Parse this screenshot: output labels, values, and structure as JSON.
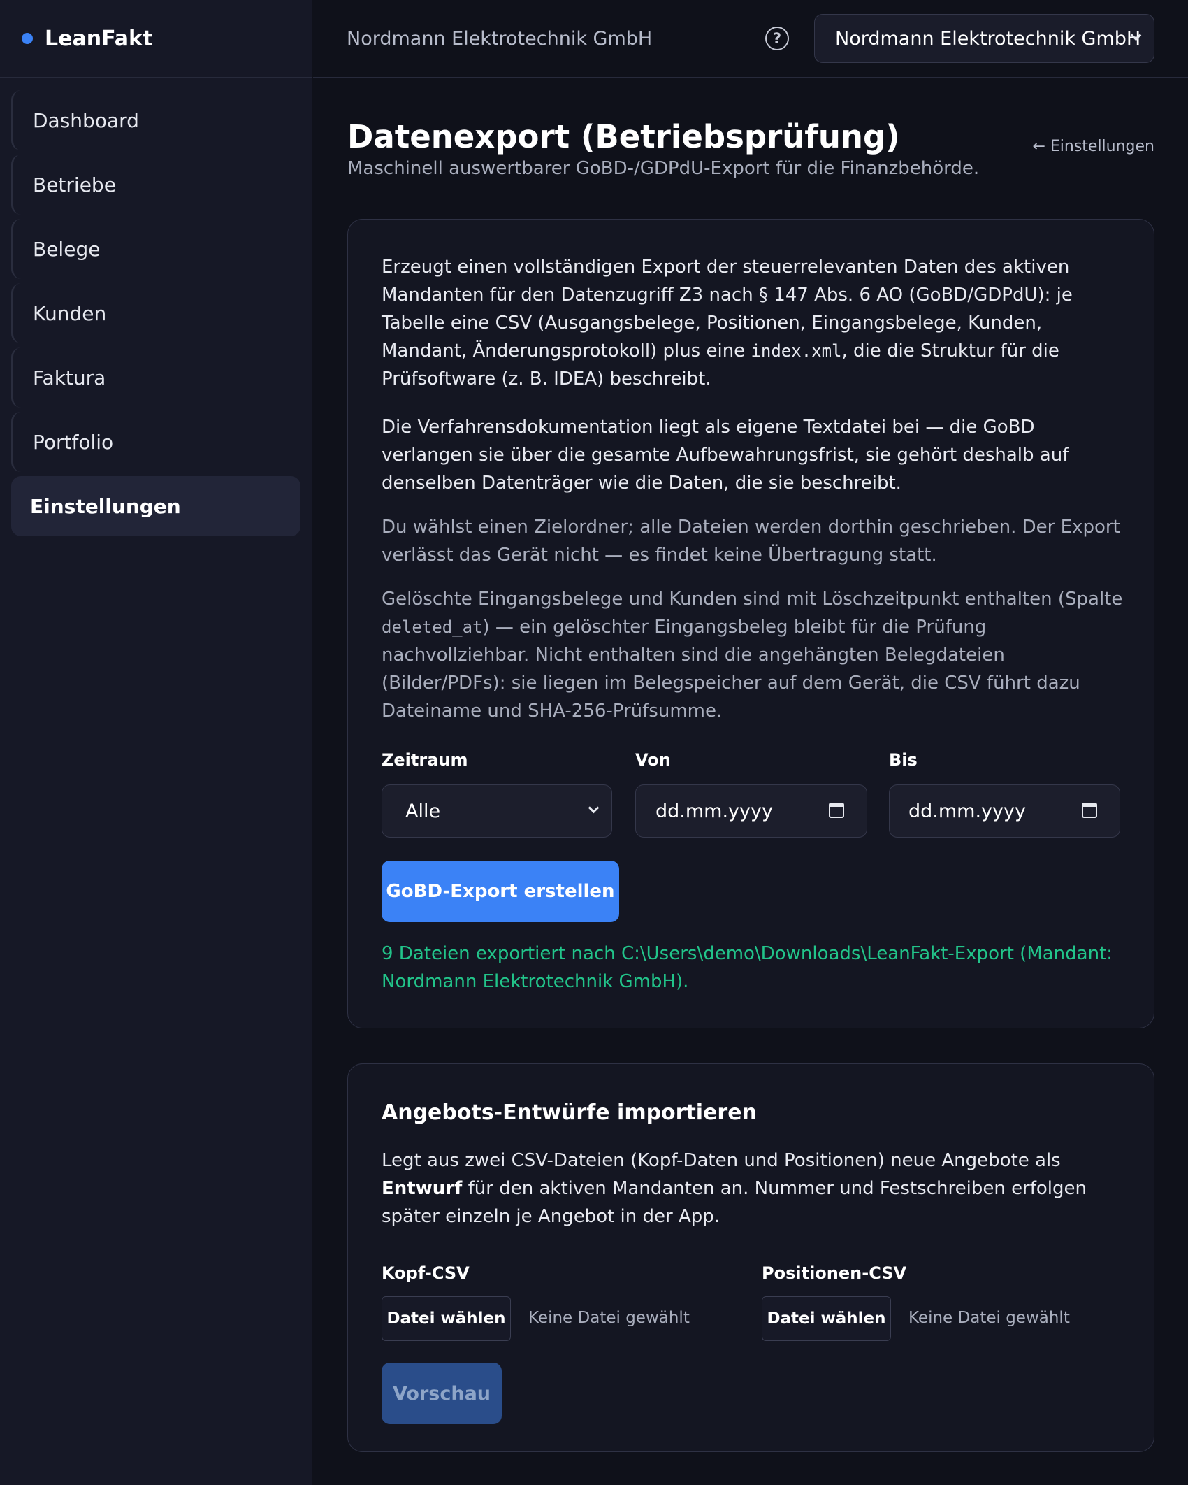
{
  "app": {
    "name": "LeanFakt"
  },
  "sidebar": {
    "items": [
      {
        "label": "Dashboard"
      },
      {
        "label": "Betriebe"
      },
      {
        "label": "Belege"
      },
      {
        "label": "Kunden"
      },
      {
        "label": "Faktura"
      },
      {
        "label": "Portfolio"
      },
      {
        "label": "Einstellungen",
        "active": true
      }
    ]
  },
  "topbar": {
    "company": "Nordmann Elektrotechnik GmbH",
    "help_icon": "question-circle-icon",
    "help_glyph": "?",
    "tenant_selected": "Nordmann Elektrotechnik GmbH"
  },
  "page": {
    "title": "Datenexport (Betriebsprüfung)",
    "subtitle": "Maschinell auswertbarer GoBD-/GDPdU-Export für die Finanzbehörde.",
    "back_link": "← Einstellungen"
  },
  "export": {
    "p1_a": "Erzeugt einen vollständigen Export der steuerrelevanten Daten des aktiven Mandanten für den Datenzugriff Z3 nach § 147 Abs. 6 AO (GoBD/GDPdU): je Tabelle eine CSV (Ausgangsbelege, Positionen, Eingangsbelege, Kunden, Mandant, Änderungsprotokoll) plus eine ",
    "p1_code": "index.xml",
    "p1_b": ", die die Struktur für die Prüfsoftware (z. B. IDEA) beschreibt.",
    "p2": "Die Verfahrensdokumentation liegt als eigene Textdatei bei — die GoBD verlangen sie über die gesamte Aufbewahrungsfrist, sie gehört deshalb auf denselben Datenträger wie die Daten, die sie beschreibt.",
    "p3": "Du wählst einen Zielordner; alle Dateien werden dorthin geschrieben. Der Export verlässt das Gerät nicht — es findet keine Übertragung statt.",
    "p4_a": "Gelöschte Eingangsbelege und Kunden sind mit Löschzeitpunkt enthalten (Spalte ",
    "p4_code": "deleted_at",
    "p4_b": ") — ein gelöschter Eingangsbeleg bleibt für die Prüfung nachvollziehbar. Nicht enthalten sind die angehängten Belegdateien (Bilder/PDFs): sie liegen im Belegspeicher auf dem Gerät, die CSV führt dazu Dateiname und SHA-256-Prüfsumme.",
    "zeitraum_label": "Zeitraum",
    "zeitraum_value": "Alle",
    "von_label": "Von",
    "von_placeholder": "dd.mm.yyyy",
    "bis_label": "Bis",
    "bis_placeholder": "dd.mm.yyyy",
    "button": "GoBD-Export erstellen",
    "result": "9 Dateien exportiert nach C:\\Users\\demo\\Downloads\\LeanFakt-Export (Mandant: Nordmann Elektrotechnik GmbH)."
  },
  "import": {
    "title": "Angebots-Entwürfe importieren",
    "desc_a": "Legt aus zwei CSV-Dateien (Kopf-Daten und Positionen) neue Angebote als ",
    "desc_bold": "Entwurf",
    "desc_b": " für den aktiven Mandanten an. Nummer und Festschreiben erfolgen später einzeln je Angebot in der App.",
    "kopf_label": "Kopf-CSV",
    "pos_label": "Positionen-CSV",
    "file_button": "Datei wählen",
    "no_file": "Keine Datei gewählt",
    "preview_button": "Vorschau"
  },
  "colors": {
    "accent": "#3b82f6",
    "success": "#22c48a",
    "background": "#0f111a",
    "sidebar": "#161826"
  }
}
